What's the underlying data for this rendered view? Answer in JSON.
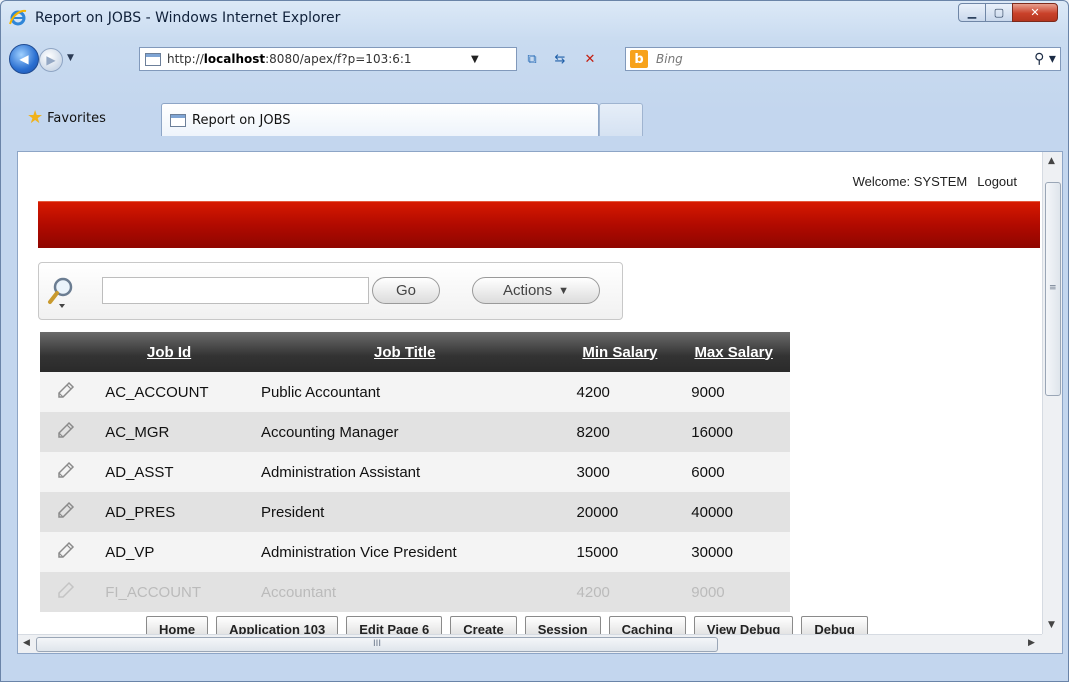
{
  "window": {
    "title": "Report on JOBS - Windows Internet Explorer",
    "min_icon": "minimize-icon",
    "max_icon": "maximize-icon",
    "close_icon": "close-icon"
  },
  "nav": {
    "url_pre": "http://",
    "url_host": "localhost",
    "url_rest": ":8080/apex/f?p=103:6:1",
    "search_placeholder": "Bing",
    "bing_letter": "b"
  },
  "favorites": {
    "label": "Favorites"
  },
  "tab": {
    "label": "Report on JOBS"
  },
  "page": {
    "welcome": "Welcome: SYSTEM",
    "logout": "Logout",
    "brand_color": "#b10a00",
    "search": {
      "go_label": "Go",
      "actions_label": "Actions",
      "query": ""
    },
    "report": {
      "headers": [
        "Job Id",
        "Job Title",
        "Min Salary",
        "Max Salary"
      ],
      "rows": [
        {
          "job_id": "AC_ACCOUNT",
          "job_title": "Public Accountant",
          "min_salary": "4200",
          "max_salary": "9000"
        },
        {
          "job_id": "AC_MGR",
          "job_title": "Accounting Manager",
          "min_salary": "8200",
          "max_salary": "16000"
        },
        {
          "job_id": "AD_ASST",
          "job_title": "Administration Assistant",
          "min_salary": "3000",
          "max_salary": "6000"
        },
        {
          "job_id": "AD_PRES",
          "job_title": "President",
          "min_salary": "20000",
          "max_salary": "40000"
        },
        {
          "job_id": "AD_VP",
          "job_title": "Administration Vice President",
          "min_salary": "15000",
          "max_salary": "30000"
        },
        {
          "job_id": "FI_ACCOUNT",
          "job_title": "Accountant",
          "min_salary": "4200",
          "max_salary": "9000"
        }
      ]
    },
    "developer_toolbar": [
      "Home",
      "Application 103",
      "Edit Page 6",
      "Create",
      "Session",
      "Caching",
      "View Debug",
      "Debug"
    ]
  },
  "scroll": {
    "h_grip": "III",
    "v_grip": "≡"
  }
}
